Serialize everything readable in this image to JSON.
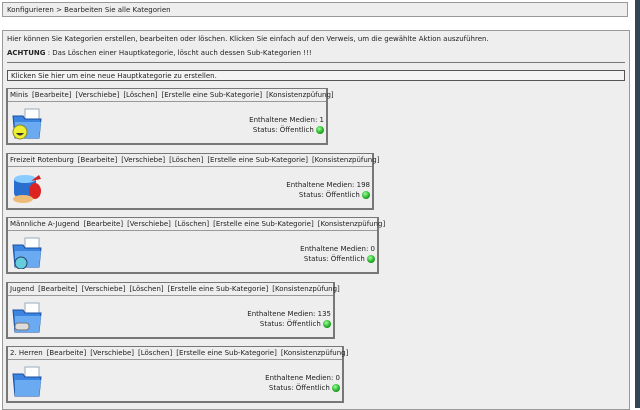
{
  "breadcrumb": "Konfigurieren > Bearbeiten Sie alle Kategorien",
  "intro": "Hier können Sie Kategorien erstellen, bearbeiten oder löschen. Klicken Sie einfach auf den Verweis, um die gewählte Aktion auszuführen.",
  "warning_label": "ACHTUNG",
  "warning_text": " : Das Löschen einer Hauptkategorie, löscht auch dessen Sub-Kategorien !!!",
  "new_category": "Klicken Sie hier um eine neue Hauptkategorie zu erstellen.",
  "actions": [
    "[Bearbeite]",
    "[Verschiebe]",
    "[Löschen]",
    "[Erstelle eine Sub-Kategorie]",
    "[Konsistenzpüfung]"
  ],
  "media_label": "Enthaltene Medien: ",
  "status_label": "Status: Öffentlich",
  "status_color": "#22aa22",
  "categories": [
    {
      "name": "Minis",
      "media": "1",
      "icon": "smiley-folder-icon"
    },
    {
      "name": "Freizeit Rotenburg",
      "media": "198",
      "icon": "sand-bucket-icon"
    },
    {
      "name": "Männliche A-Jugend",
      "media": "0",
      "icon": "globe-folder-icon"
    },
    {
      "name": "Jugend",
      "media": "135",
      "icon": "gamepad-folder-icon"
    },
    {
      "name": "2. Herren",
      "media": "0",
      "icon": "folder-icon"
    }
  ]
}
